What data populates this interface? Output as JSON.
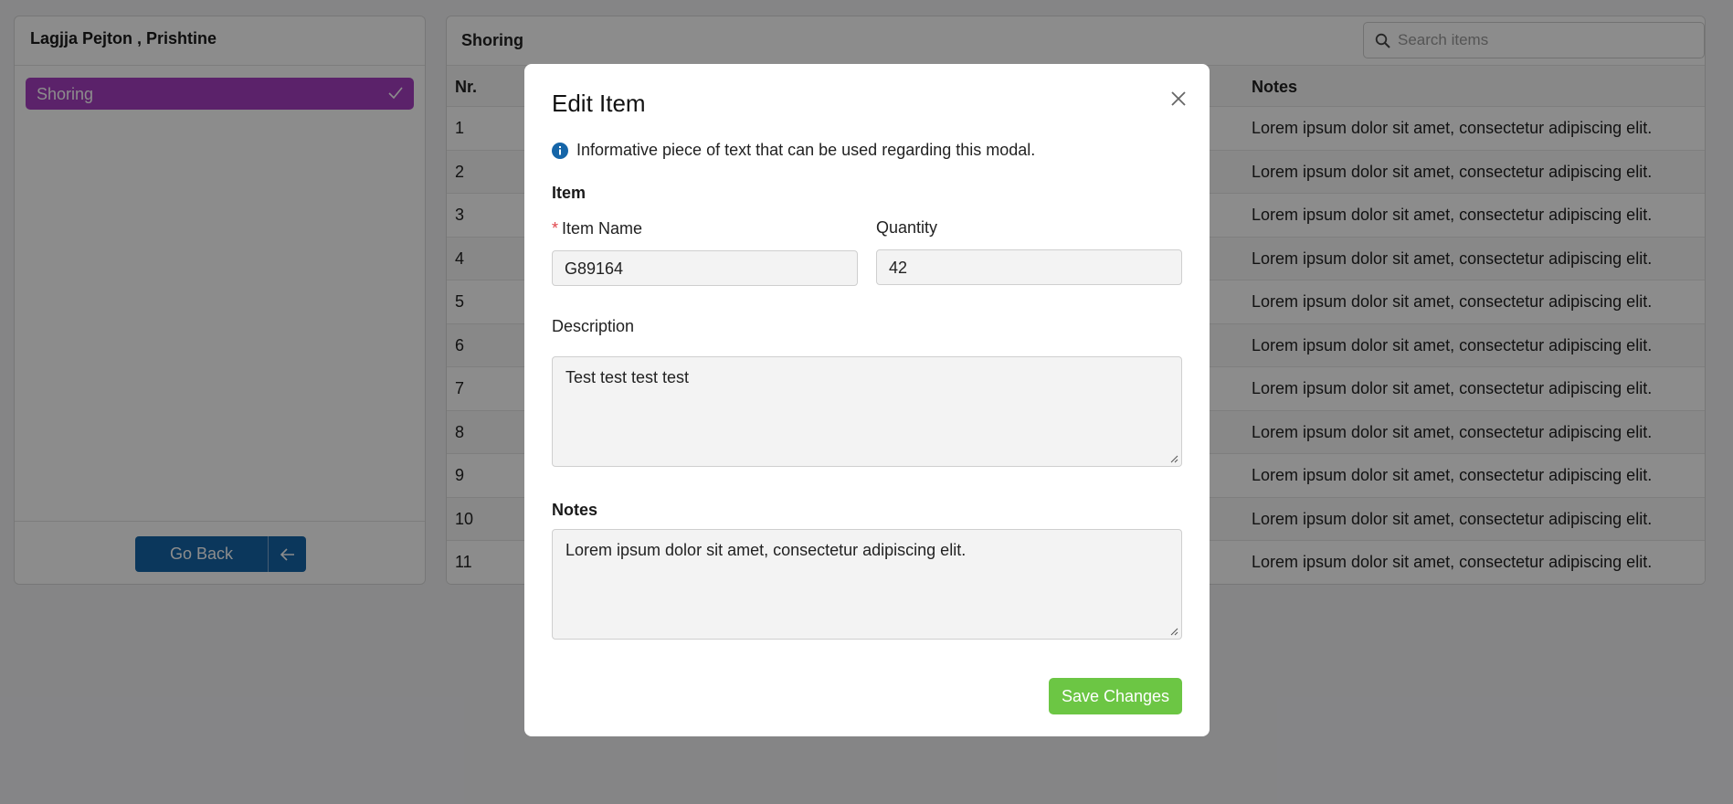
{
  "sidebar": {
    "title": "Lagjja Pejton , Prishtine",
    "items": [
      {
        "label": "Shoring",
        "selected": true
      }
    ],
    "go_back_label": "Go Back"
  },
  "main": {
    "title": "Shoring",
    "search": {
      "placeholder": "Search items",
      "value": ""
    },
    "table": {
      "columns": {
        "nr": "Nr.",
        "notes": "Notes"
      },
      "rows": [
        {
          "nr": "1",
          "notes": "Lorem ipsum dolor sit amet, consectetur adipiscing elit."
        },
        {
          "nr": "2",
          "notes": "Lorem ipsum dolor sit amet, consectetur adipiscing elit."
        },
        {
          "nr": "3",
          "notes": "Lorem ipsum dolor sit amet, consectetur adipiscing elit."
        },
        {
          "nr": "4",
          "notes": "Lorem ipsum dolor sit amet, consectetur adipiscing elit."
        },
        {
          "nr": "5",
          "notes": "Lorem ipsum dolor sit amet, consectetur adipiscing elit."
        },
        {
          "nr": "6",
          "notes": "Lorem ipsum dolor sit amet, consectetur adipiscing elit."
        },
        {
          "nr": "7",
          "notes": "Lorem ipsum dolor sit amet, consectetur adipiscing elit."
        },
        {
          "nr": "8",
          "notes": "Lorem ipsum dolor sit amet, consectetur adipiscing elit."
        },
        {
          "nr": "9",
          "notes": "Lorem ipsum dolor sit amet, consectetur adipiscing elit."
        },
        {
          "nr": "10",
          "notes": "Lorem ipsum dolor sit amet, consectetur adipiscing elit."
        },
        {
          "nr": "11",
          "notes": "Lorem ipsum dolor sit amet, consectetur adipiscing elit."
        }
      ]
    }
  },
  "modal": {
    "title": "Edit Item",
    "info_text": "Informative piece of text that can be used regarding this modal.",
    "item_section": "Item",
    "item_name_label": "Item Name",
    "item_name_required": "*",
    "item_name_value": "G89164",
    "quantity_label": "Quantity",
    "quantity_value": "42",
    "description_label": "Description",
    "description_value": "Test test test test",
    "notes_label": "Notes",
    "notes_value": "Lorem ipsum dolor sit amet, consectetur adipiscing elit.",
    "save_label": "Save Changes"
  },
  "icons": {
    "check": "check-icon",
    "arrow_left": "arrow-left-icon",
    "search": "search-icon",
    "close": "close-icon",
    "info": "info-icon"
  },
  "colors": {
    "selected_item": "#a63fc2",
    "primary_button": "#1565a8",
    "save_button": "#6cc644",
    "info_icon": "#1565a8",
    "required_marker": "#e0454b"
  }
}
